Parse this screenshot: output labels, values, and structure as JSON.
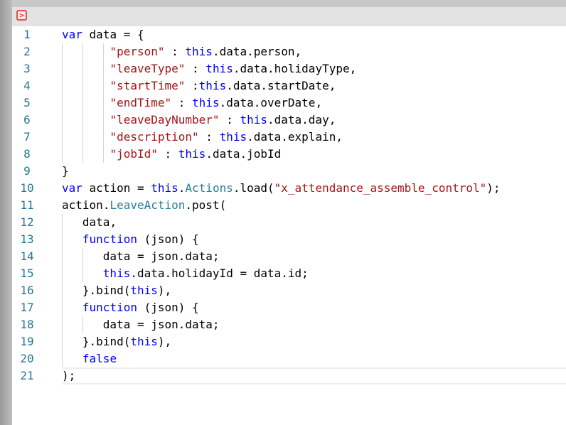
{
  "toggle_icon": "chevron-right-icon",
  "toggle_glyph": ">",
  "current_line": 21,
  "colors": {
    "keyword": "#0000ff",
    "string": "#a31515",
    "class": "#267f99",
    "line_number": "#237893"
  },
  "lines": [
    {
      "n": "1",
      "indent": 0,
      "tokens": [
        [
          "kw",
          "var"
        ],
        [
          "pl",
          " data = {"
        ]
      ]
    },
    {
      "n": "2",
      "indent": 3,
      "pad": "       ",
      "tokens": [
        [
          "str",
          "\"person\""
        ],
        [
          "pl",
          " : "
        ],
        [
          "kw",
          "this"
        ],
        [
          "pl",
          ".data.person,"
        ]
      ]
    },
    {
      "n": "3",
      "indent": 3,
      "pad": "       ",
      "tokens": [
        [
          "str",
          "\"leaveType\""
        ],
        [
          "pl",
          " : "
        ],
        [
          "kw",
          "this"
        ],
        [
          "pl",
          ".data.holidayType,"
        ]
      ]
    },
    {
      "n": "4",
      "indent": 3,
      "pad": "       ",
      "tokens": [
        [
          "str",
          "\"startTime\""
        ],
        [
          "pl",
          " :"
        ],
        [
          "kw",
          "this"
        ],
        [
          "pl",
          ".data.startDate,"
        ]
      ]
    },
    {
      "n": "5",
      "indent": 3,
      "pad": "       ",
      "tokens": [
        [
          "str",
          "\"endTime\""
        ],
        [
          "pl",
          " : "
        ],
        [
          "kw",
          "this"
        ],
        [
          "pl",
          ".data.overDate,"
        ]
      ]
    },
    {
      "n": "6",
      "indent": 3,
      "pad": "       ",
      "tokens": [
        [
          "str",
          "\"leaveDayNumber\""
        ],
        [
          "pl",
          " : "
        ],
        [
          "kw",
          "this"
        ],
        [
          "pl",
          ".data.day,"
        ]
      ]
    },
    {
      "n": "7",
      "indent": 3,
      "pad": "       ",
      "tokens": [
        [
          "str",
          "\"description\""
        ],
        [
          "pl",
          " : "
        ],
        [
          "kw",
          "this"
        ],
        [
          "pl",
          ".data.explain,"
        ]
      ]
    },
    {
      "n": "8",
      "indent": 3,
      "pad": "       ",
      "tokens": [
        [
          "str",
          "\"jobId\""
        ],
        [
          "pl",
          " : "
        ],
        [
          "kw",
          "this"
        ],
        [
          "pl",
          ".data.jobId"
        ]
      ]
    },
    {
      "n": "9",
      "indent": 0,
      "tokens": [
        [
          "pl",
          "}"
        ]
      ]
    },
    {
      "n": "10",
      "indent": 0,
      "tokens": [
        [
          "kw",
          "var"
        ],
        [
          "pl",
          " action = "
        ],
        [
          "kw",
          "this"
        ],
        [
          "pl",
          "."
        ],
        [
          "cls",
          "Actions"
        ],
        [
          "pl",
          ".load("
        ],
        [
          "str",
          "\"x_attendance_assemble_control\""
        ],
        [
          "pl",
          ");"
        ]
      ]
    },
    {
      "n": "11",
      "indent": 0,
      "tokens": [
        [
          "pl",
          "action."
        ],
        [
          "cls",
          "LeaveAction"
        ],
        [
          "pl",
          ".post("
        ]
      ]
    },
    {
      "n": "12",
      "indent": 1,
      "pad": "   ",
      "tokens": [
        [
          "pl",
          "data,"
        ]
      ]
    },
    {
      "n": "13",
      "indent": 1,
      "pad": "   ",
      "tokens": [
        [
          "kw",
          "function"
        ],
        [
          "pl",
          " (json) {"
        ]
      ]
    },
    {
      "n": "14",
      "indent": 2,
      "pad": "      ",
      "tokens": [
        [
          "pl",
          "data = json.data;"
        ]
      ]
    },
    {
      "n": "15",
      "indent": 2,
      "pad": "      ",
      "tokens": [
        [
          "kw",
          "this"
        ],
        [
          "pl",
          ".data.holidayId = data.id;"
        ]
      ]
    },
    {
      "n": "16",
      "indent": 1,
      "pad": "   ",
      "tokens": [
        [
          "pl",
          "}.bind("
        ],
        [
          "kw",
          "this"
        ],
        [
          "pl",
          "),"
        ]
      ]
    },
    {
      "n": "17",
      "indent": 1,
      "pad": "   ",
      "tokens": [
        [
          "kw",
          "function"
        ],
        [
          "pl",
          " (json) {"
        ]
      ]
    },
    {
      "n": "18",
      "indent": 2,
      "pad": "      ",
      "tokens": [
        [
          "pl",
          "data = json.data;"
        ]
      ]
    },
    {
      "n": "19",
      "indent": 1,
      "pad": "   ",
      "tokens": [
        [
          "pl",
          "}.bind("
        ],
        [
          "kw",
          "this"
        ],
        [
          "pl",
          "),"
        ]
      ]
    },
    {
      "n": "20",
      "indent": 1,
      "pad": "   ",
      "tokens": [
        [
          "kw",
          "false"
        ]
      ]
    },
    {
      "n": "21",
      "indent": 0,
      "tokens": [
        [
          "pl",
          ");"
        ]
      ]
    }
  ]
}
